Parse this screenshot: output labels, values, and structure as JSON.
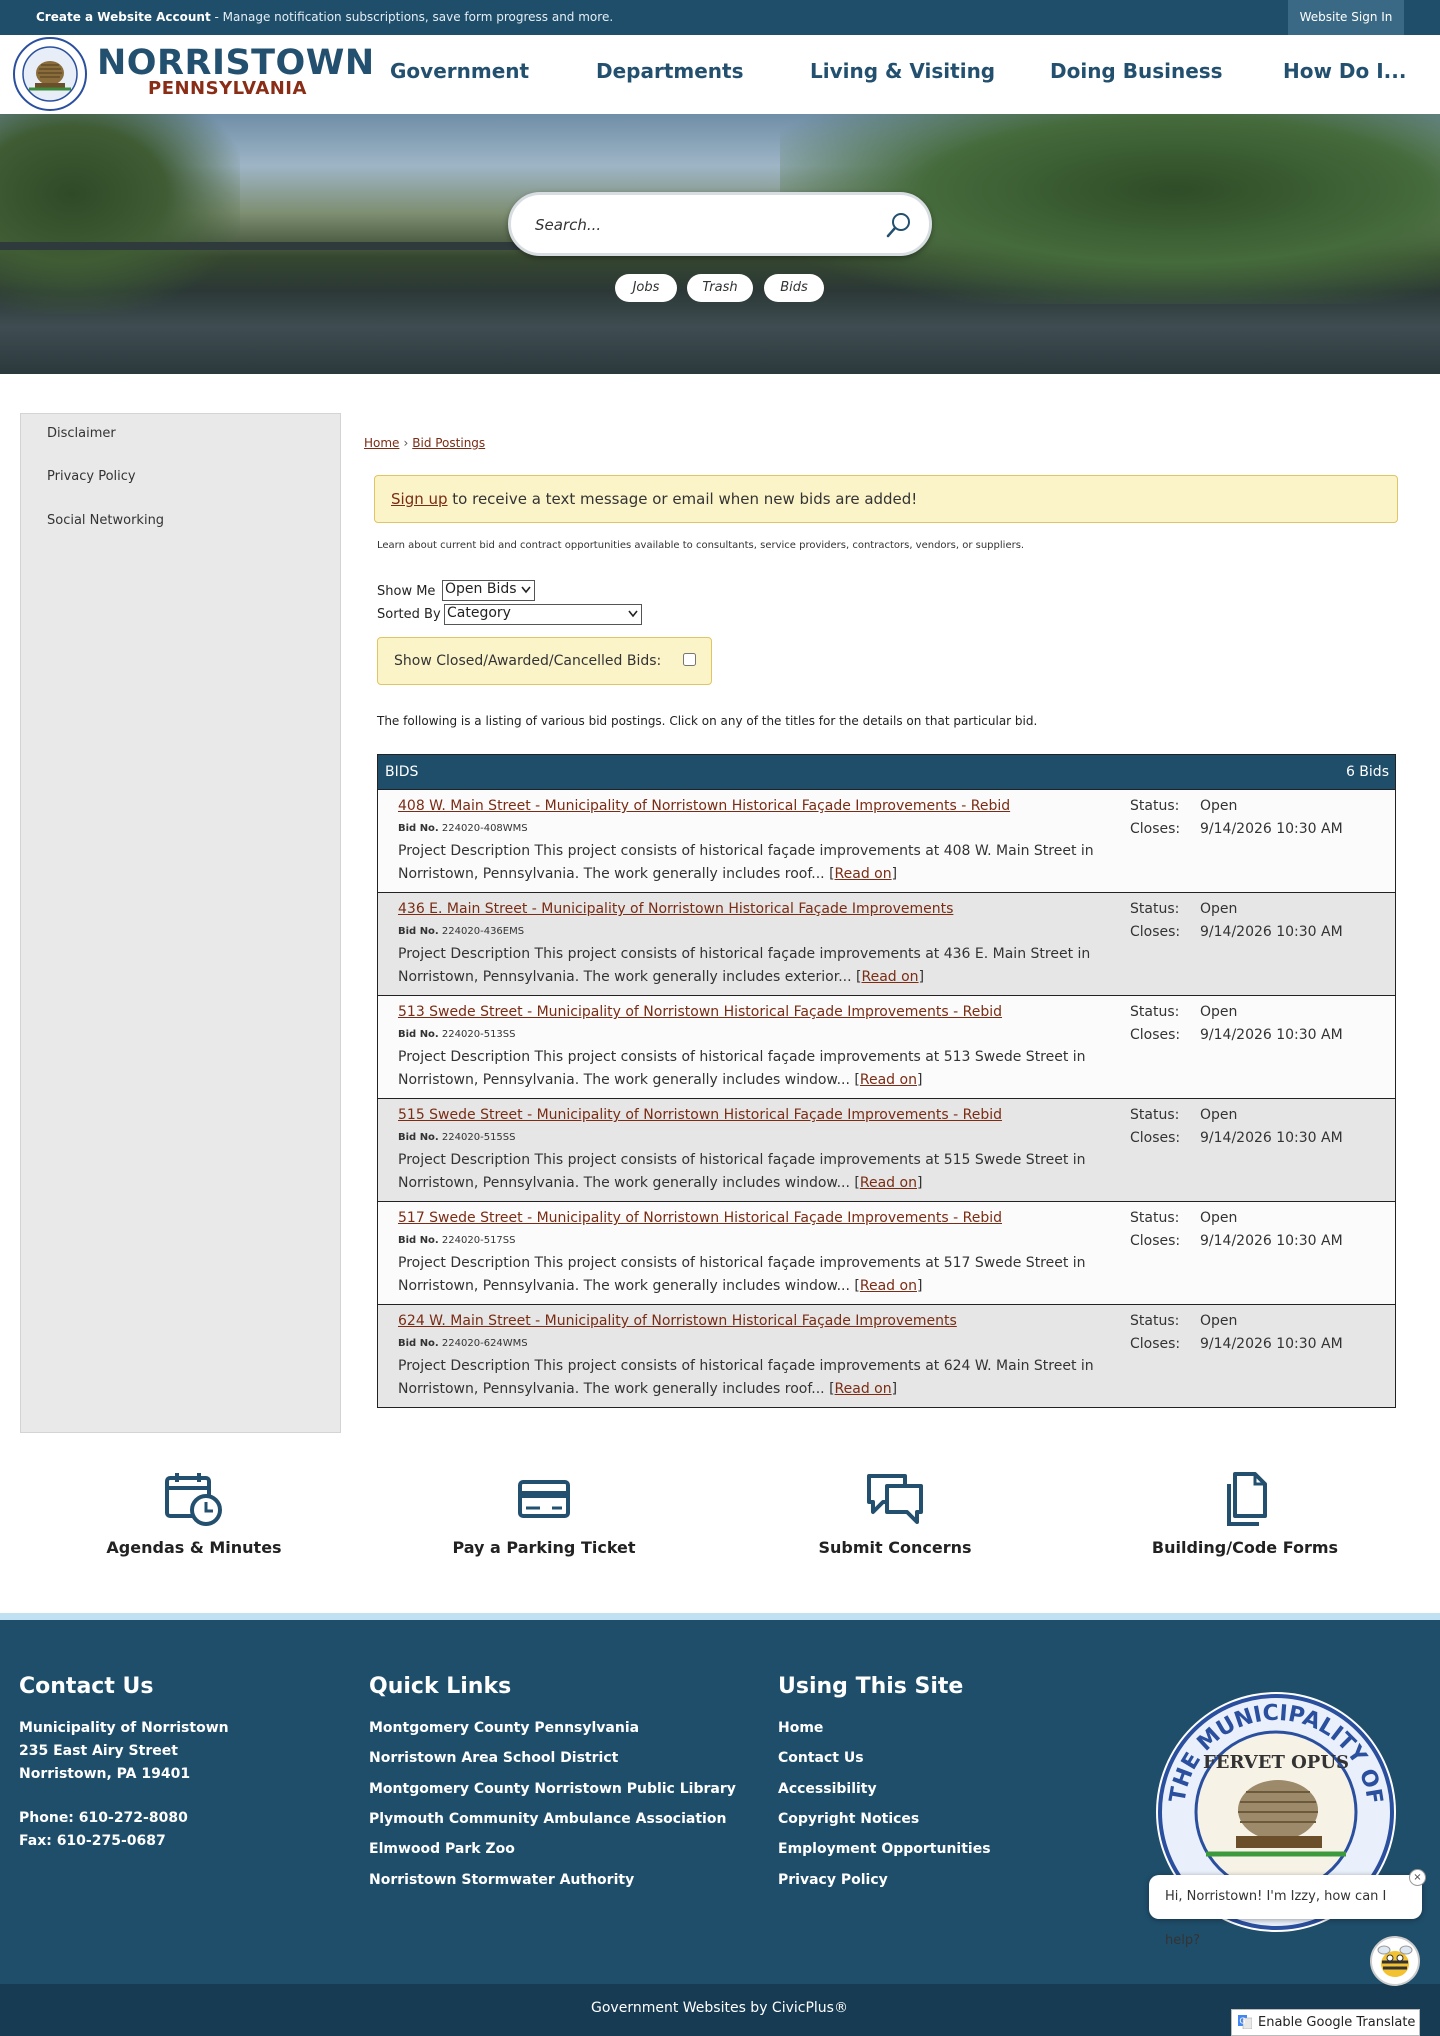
{
  "topbar": {
    "create_account": "Create a Website Account",
    "create_account_sub": " - Manage notification subscriptions, save form progress and more.",
    "signin": "Website Sign In"
  },
  "logo": {
    "name": "NORRISTOWN",
    "sub": "PENNSYLVANIA"
  },
  "nav": [
    "Government",
    "Departments",
    "Living & Visiting",
    "Doing Business",
    "How Do I..."
  ],
  "search": {
    "placeholder": "Search...",
    "pills": [
      "Jobs",
      "Trash",
      "Bids"
    ]
  },
  "sidebar": [
    "Disclaimer",
    "Privacy Policy",
    "Social Networking"
  ],
  "breadcrumb": {
    "home": "Home",
    "sep": "›",
    "current": "Bid Postings"
  },
  "signup": {
    "link": "Sign up",
    "text": " to receive a text message or email when new bids are added!"
  },
  "intro": "Learn about current bid and contract opportunities available to consultants, service providers, contractors, vendors, or suppliers.",
  "filters": {
    "show_me_label": "Show Me",
    "show_me_value": "Open Bids",
    "sorted_by_label": "Sorted By",
    "sorted_by_value": "Category",
    "closed_label": "Show Closed/Awarded/Cancelled Bids:"
  },
  "listing_note": "The following is a listing of various bid postings. Click on any of the titles for the details on that particular bid.",
  "bids": {
    "header": "BIDS",
    "count": "6 Bids",
    "status_label": "Status:",
    "closes_label": "Closes:",
    "bidno_label": "Bid No.",
    "read_on": "Read on",
    "items": [
      {
        "title": "408 W. Main Street - Municipality of Norristown Historical Façade Improvements - Rebid",
        "bid_no": "224020-408WMS",
        "desc1": "Project Description This project consists of historical façade improvements at 408 W. Main Street in",
        "desc2": "Norristown, Pennsylvania. The work generally includes roof... ",
        "status": "Open",
        "closes": "9/14/2026 10:30 AM"
      },
      {
        "title": "436 E. Main Street - Municipality of Norristown Historical Façade Improvements",
        "bid_no": "224020-436EMS",
        "desc1": "Project Description This project consists of historical façade improvements at 436 E. Main Street in",
        "desc2": "Norristown, Pennsylvania. The work generally includes exterior... ",
        "status": "Open",
        "closes": "9/14/2026 10:30 AM"
      },
      {
        "title": "513 Swede Street - Municipality of Norristown Historical Façade Improvements - Rebid",
        "bid_no": "224020-513SS",
        "desc1": "Project Description This project consists of historical façade improvements at 513 Swede Street in",
        "desc2": "Norristown, Pennsylvania. The work generally includes window... ",
        "status": "Open",
        "closes": "9/14/2026 10:30 AM"
      },
      {
        "title": "515 Swede Street - Municipality of Norristown Historical Façade Improvements - Rebid",
        "bid_no": "224020-515SS",
        "desc1": "Project Description This project consists of historical façade improvements at 515 Swede Street in",
        "desc2": "Norristown, Pennsylvania. The work generally includes window... ",
        "status": "Open",
        "closes": "9/14/2026 10:30 AM"
      },
      {
        "title": "517 Swede Street - Municipality of Norristown Historical Façade Improvements - Rebid",
        "bid_no": "224020-517SS",
        "desc1": "Project Description This project consists of historical façade improvements at 517 Swede Street in",
        "desc2": "Norristown, Pennsylvania. The work generally includes window... ",
        "status": "Open",
        "closes": "9/14/2026 10:30 AM"
      },
      {
        "title": "624 W. Main Street - Municipality of Norristown Historical Façade Improvements",
        "bid_no": "224020-624WMS",
        "desc1": "Project Description This project consists of historical façade improvements at 624 W. Main Street in",
        "desc2": "Norristown, Pennsylvania. The work generally includes roof... ",
        "status": "Open",
        "closes": "9/14/2026 10:30 AM"
      }
    ]
  },
  "quick_access": [
    "Agendas & Minutes",
    "Pay a Parking Ticket",
    "Submit Concerns",
    "Building/Code Forms"
  ],
  "footer": {
    "contact": {
      "title": "Contact Us",
      "org": "Municipality of Norristown",
      "street": "235 East Airy Street",
      "city": "Norristown, PA 19401",
      "phone": "Phone: 610-272-8080",
      "fax": "Fax: 610-275-0687"
    },
    "quick_links": {
      "title": "Quick Links",
      "items": [
        "Montgomery County Pennsylvania",
        "Norristown Area School District",
        "Montgomery County Norristown Public Library",
        "Plymouth Community Ambulance Association",
        "Elmwood Park Zoo",
        "Norristown Stormwater Authority"
      ]
    },
    "using_site": {
      "title": "Using This Site",
      "items": [
        "Home",
        "Contact Us",
        "Accessibility",
        "Copyright Notices",
        "Employment Opportunities",
        "Privacy Policy"
      ]
    },
    "seal_text": "THE MUNICIPALITY OF NORRISTOWN",
    "seal_motto": "FERVET OPUS",
    "copyright": "Government Websites by CivicPlus®"
  },
  "chat": {
    "message": "Hi, Norristown! I'm Izzy, how can I help?",
    "close": "×"
  },
  "translate": "Enable Google Translate",
  "colors": {
    "primary": "#1f4e6b",
    "accent": "#8a2d16",
    "highlight": "#fcf4c9"
  }
}
